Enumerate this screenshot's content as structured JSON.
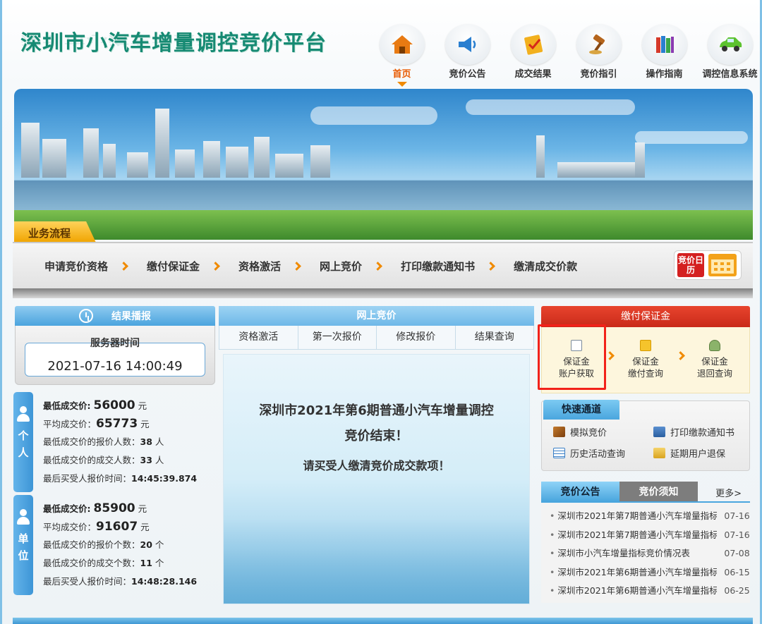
{
  "header": {
    "site_title": "深圳市小汽车增量调控竞价平台",
    "nav": [
      {
        "label": "首页",
        "icon": "home-icon",
        "active": true
      },
      {
        "label": "竞价公告",
        "icon": "speaker-icon"
      },
      {
        "label": "成交结果",
        "icon": "checklist-icon"
      },
      {
        "label": "竞价指引",
        "icon": "gavel-icon"
      },
      {
        "label": "操作指南",
        "icon": "books-icon"
      },
      {
        "label": "调控信息系统",
        "icon": "car-icon"
      }
    ]
  },
  "process": {
    "tag": "业务流程",
    "steps": [
      "申请竞价资格",
      "缴付保证金",
      "资格激活",
      "网上竞价",
      "打印缴款通知书",
      "缴清成交价款"
    ],
    "calendar_label": "竞价日历"
  },
  "result": {
    "header": "结果播报",
    "server_label": "服务器时间",
    "server_time": "2021-07-16 14:00:49",
    "personal": {
      "tab": "个人",
      "min_price_label": "最低成交价:",
      "min_price": "56000",
      "unit": "元",
      "avg_price_label": "平均成交价：",
      "avg_price": "65773",
      "min_bid_count_label": "最低成交价的报价人数：",
      "min_bid_count": "38",
      "min_deal_count_label": "最低成交价的成交人数：",
      "min_deal_count": "33",
      "count_unit": "人",
      "last_time_label": "最后买受人报价时间：",
      "last_time": "14:45:39.874"
    },
    "company": {
      "tab": "单位",
      "min_price_label": "最低成交价:",
      "min_price": "85900",
      "unit": "元",
      "avg_price_label": "平均成交价：",
      "avg_price": "91607",
      "min_bid_count_label": "最低成交价的报价个数：",
      "min_bid_count": "20",
      "min_deal_count_label": "最低成交价的成交个数：",
      "min_deal_count": "11",
      "count_unit": "个",
      "last_time_label": "最后买受人报价时间：",
      "last_time": "14:48:28.146"
    }
  },
  "online_bid": {
    "header": "网上竞价",
    "tabs": [
      "资格激活",
      "第一次报价",
      "修改报价",
      "结果查询"
    ],
    "notice_line1": "深圳市2021年第6期普通小汽车增量调控",
    "notice_line2": "竞价结束！",
    "notice_line3": "请买受人缴清竞价成交款项！"
  },
  "deposit": {
    "header": "缴付保证金",
    "items": [
      {
        "line1": "保证金",
        "line2": "账户获取"
      },
      {
        "line1": "保证金",
        "line2": "缴付查询"
      },
      {
        "line1": "保证金",
        "line2": "退回查询"
      }
    ]
  },
  "quick": {
    "tab": "快速通道",
    "items": [
      "模拟竞价",
      "打印缴款通知书",
      "历史活动查询",
      "延期用户退保"
    ]
  },
  "announcements": {
    "tabs": [
      "竞价公告",
      "竞价须知"
    ],
    "more": "更多>",
    "items": [
      {
        "title": "深圳市2021年第7期普通小汽车增量指标",
        "date": "07-16"
      },
      {
        "title": "深圳市2021年第7期普通小汽车增量指标",
        "date": "07-16"
      },
      {
        "title": "深圳市小汽车增量指标竞价情况表",
        "date": "07-08"
      },
      {
        "title": "深圳市2021年第6期普通小汽车增量指标",
        "date": "06-15"
      },
      {
        "title": "深圳市2021年第6期普通小汽车增量指标",
        "date": "06-25"
      }
    ]
  },
  "colors": {
    "accent_blue": "#4aa6de",
    "brand_green": "#168a73",
    "alert_red": "#f2221a",
    "arrow_orange": "#f08a00"
  }
}
